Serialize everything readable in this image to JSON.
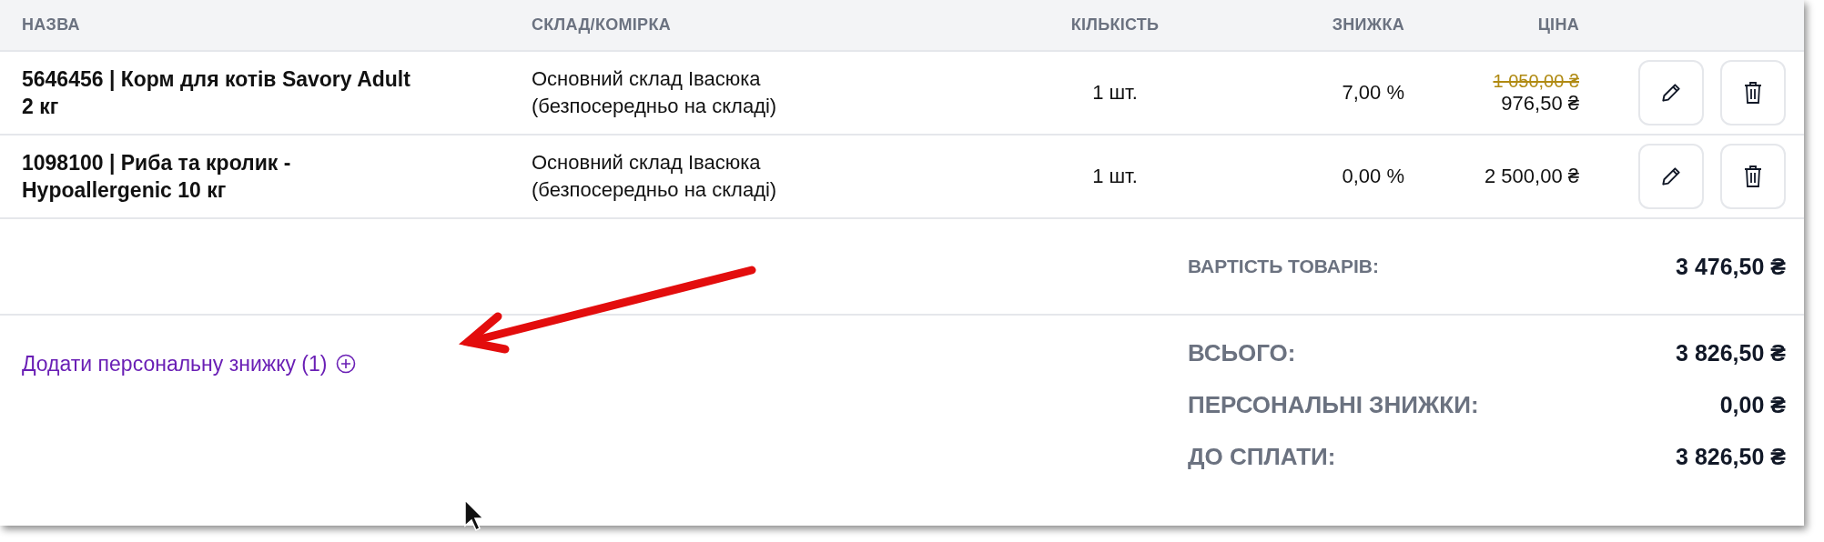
{
  "table": {
    "columns": [
      "НАЗВА",
      "СКЛАД/КОМІРКА",
      "КІЛЬКІСТЬ",
      "ЗНИЖКА",
      "ЦІНА"
    ],
    "rows": [
      {
        "name": "5646456 | Корм для котів Savory Adult 2 кг",
        "warehouse": "Основний склад Івасюка (безпосередньо на складі)",
        "quantity": "1 шт.",
        "discount": "7,00 %",
        "old_price": "1 050,00 ₴",
        "price": "976,50 ₴"
      },
      {
        "name": "1098100 | Риба та кролик - Hypoallergenic 10 кг",
        "warehouse": "Основний склад Івасюка (безпосередньо на складі)",
        "quantity": "1 шт.",
        "discount": "0,00 %",
        "price": "2 500,00 ₴"
      }
    ]
  },
  "subtotal": {
    "label": "ВАРТІСТЬ ТОВАРІВ:",
    "value": "3 476,50 ₴"
  },
  "add_discount_link": "Додати персональну знижку (1)",
  "totals": [
    {
      "label": "ВСЬОГО:",
      "value": "3 826,50 ₴"
    },
    {
      "label": "ПЕРСОНАЛЬНІ ЗНИЖКИ:",
      "value": "0,00 ₴"
    },
    {
      "label": "ДО СПЛАТИ:",
      "value": "3 826,50 ₴"
    }
  ]
}
